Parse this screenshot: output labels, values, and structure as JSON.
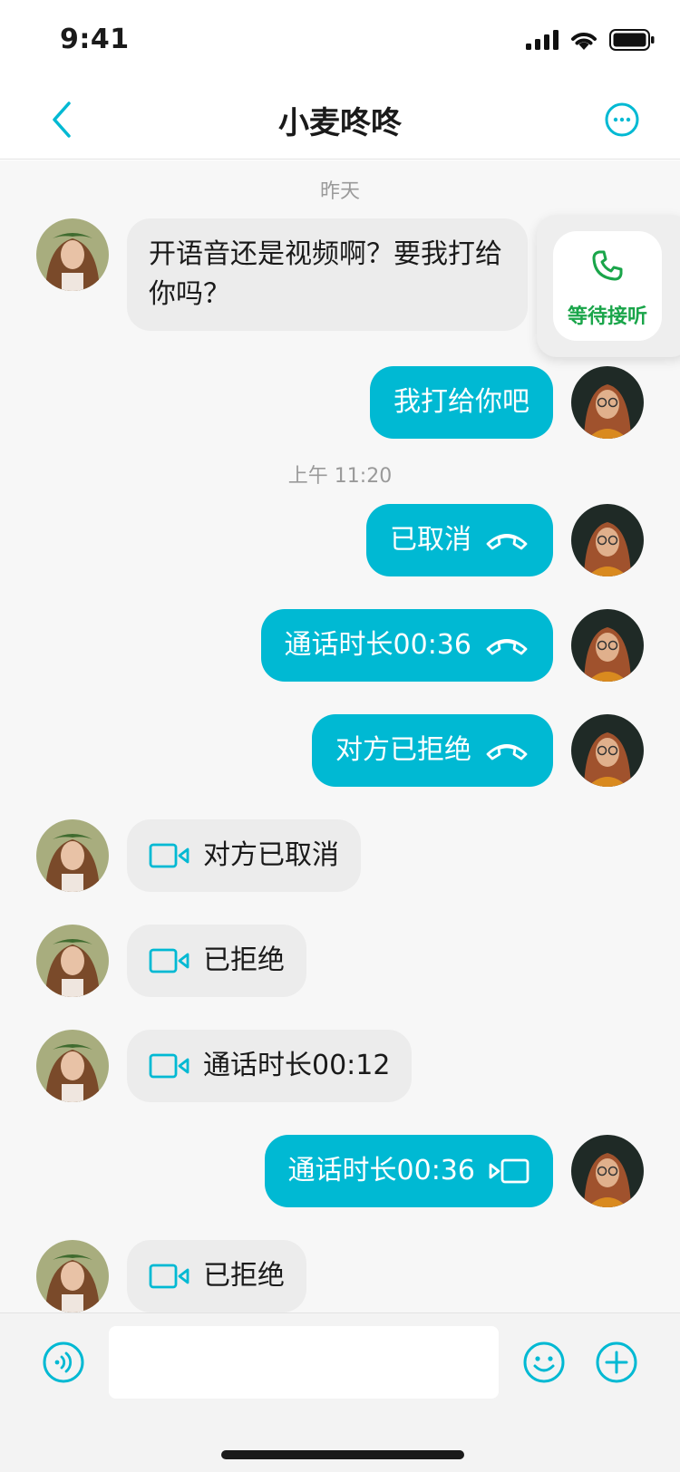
{
  "status_bar": {
    "time": "9:41"
  },
  "nav": {
    "title": "小麦咚咚"
  },
  "colors": {
    "accent": "#00b9d3",
    "green": "#1aa54a",
    "bubble_in": "#ececec"
  },
  "messages": {
    "ts_yesterday": "昨天",
    "m1": "开语音还是视频啊？要我打给你吗？",
    "m2": "我打给你吧",
    "ts_morning": "上午 11:20",
    "m3": "已取消",
    "m4": "通话时长00:36",
    "m5": "对方已拒绝",
    "m6": "对方已取消",
    "m7": "已拒绝",
    "m8": "通话时长00:12",
    "m9": "通话时长00:36",
    "m10": "已拒绝"
  },
  "call_popup": {
    "label": "等待接听",
    "icon": "phone-icon"
  },
  "input_bar": {
    "placeholder": "",
    "value": ""
  },
  "icons": [
    "back-icon",
    "more-icon",
    "hangup-icon",
    "video-icon",
    "voice-icon",
    "emoji-icon",
    "plus-icon"
  ]
}
